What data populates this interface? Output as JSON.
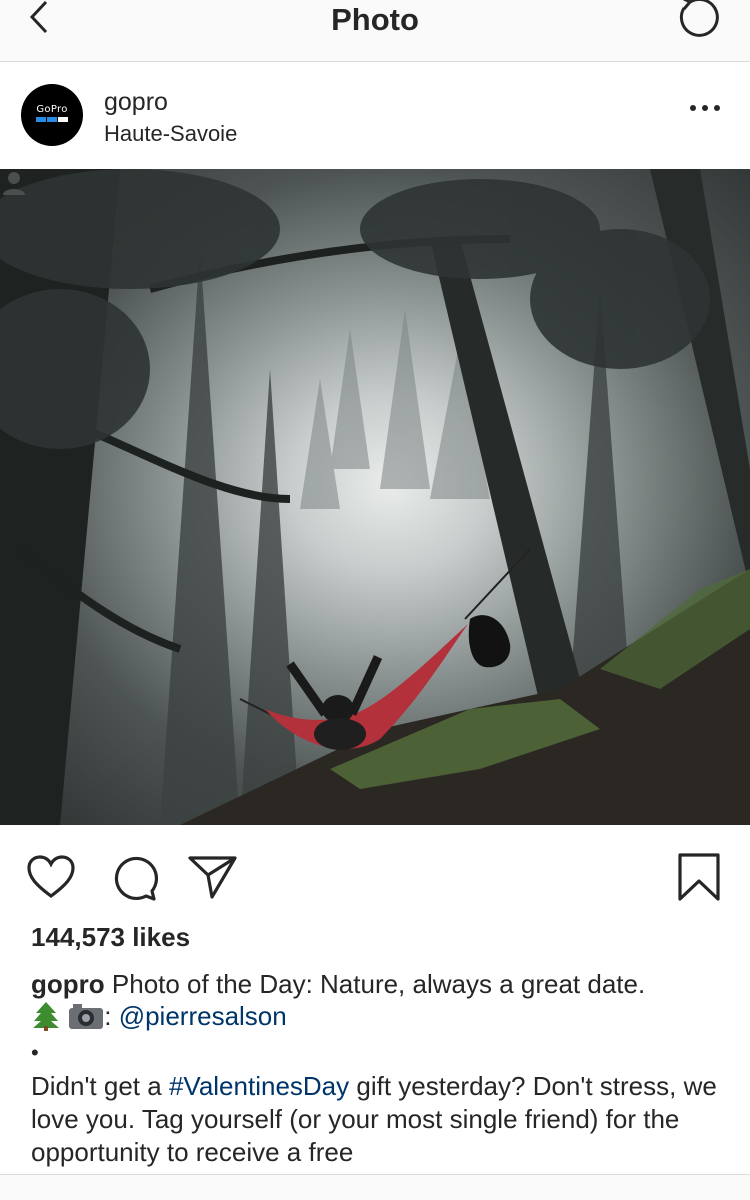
{
  "nav": {
    "title": "Photo",
    "back_icon": "chevron-left-icon",
    "refresh_icon": "refresh-icon"
  },
  "post": {
    "username": "gopro",
    "location": "Haute-Savoie",
    "avatar_text": "GoPro",
    "more_icon": "more-dots-icon"
  },
  "actions": {
    "like_icon": "heart-icon",
    "comment_icon": "comment-icon",
    "share_icon": "send-icon",
    "save_icon": "bookmark-icon"
  },
  "likes": "144,573 likes",
  "caption": {
    "username": "gopro",
    "text": "Photo of the Day: Nature, always a great date.",
    "credit_separator": ":",
    "mention": "@pierresalson",
    "bullet": "•",
    "body_1": "Didn't get a",
    "hashtag": "#ValentinesDay",
    "body_2": "gift yesterday? Don't stress, we love you. Tag yourself (or your most single friend) for the opportunity to receive a free"
  },
  "colors": {
    "link": "#003569",
    "text": "#262626",
    "nav_bg": "#fafafa",
    "hammock": "#b2313a"
  }
}
